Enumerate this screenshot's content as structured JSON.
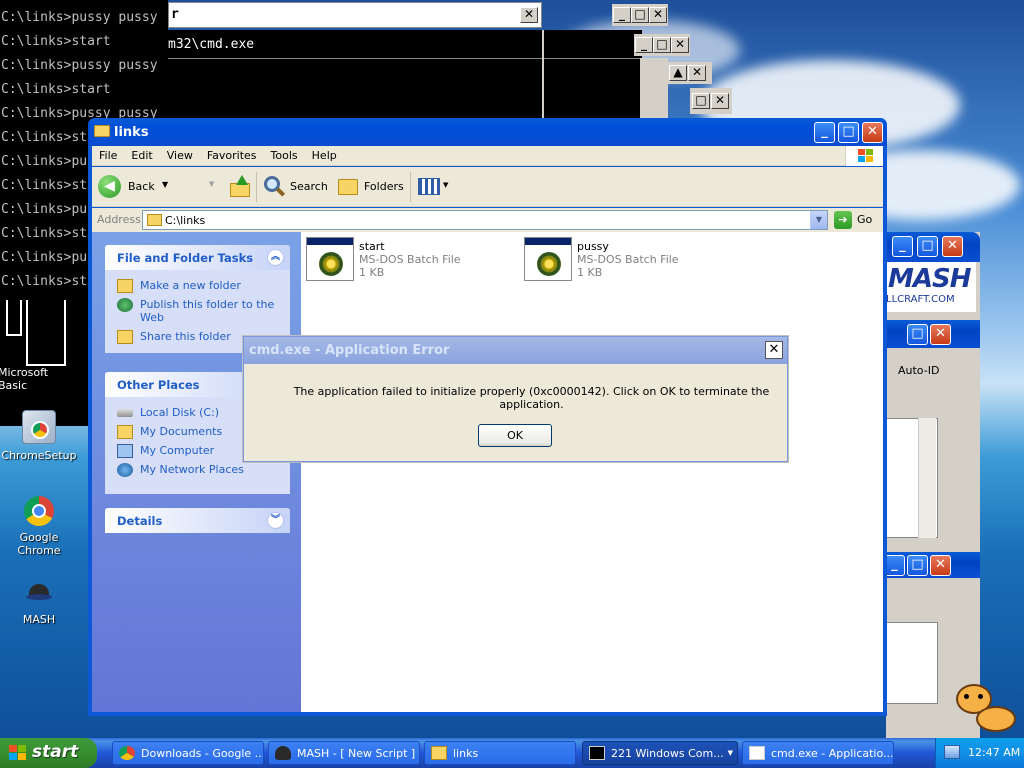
{
  "desktop": {
    "icons": [
      {
        "label": "Microsoft Basic"
      },
      {
        "label": "ChromeSetup"
      },
      {
        "label": "Google Chrome"
      },
      {
        "label": "MASH"
      }
    ]
  },
  "console": {
    "lines": [
      "C:\\links>pussy pussy",
      "C:\\links>start",
      "C:\\links>pussy pussy",
      "C:\\links>start",
      "C:\\links>pussy pussy",
      "C:\\links>st",
      "C:\\links>pu",
      "C:\\links>st",
      "C:\\links>pu",
      "C:\\links>st",
      "C:\\links>pu",
      "C:\\links>st"
    ],
    "window2_title_fragment": "r",
    "window3_title_fragment": "m32\\cmd.exe"
  },
  "explorer": {
    "title": "links",
    "menu": [
      "File",
      "Edit",
      "View",
      "Favorites",
      "Tools",
      "Help"
    ],
    "toolbar": {
      "back": "Back",
      "search": "Search",
      "folders": "Folders"
    },
    "address_label": "Address",
    "address_value": "C:\\links",
    "go_label": "Go",
    "tasks": {
      "file_folder_title": "File and Folder Tasks",
      "file_folder_items": [
        "Make a new folder",
        "Publish this folder to the Web",
        "Share this folder"
      ],
      "other_places_title": "Other Places",
      "other_places_items": [
        "Local Disk (C:)",
        "My Documents",
        "My Computer",
        "My Network Places"
      ],
      "details_title": "Details"
    },
    "files": [
      {
        "name": "start",
        "type": "MS-DOS Batch File",
        "size": "1 KB"
      },
      {
        "name": "pussy",
        "type": "MS-DOS Batch File",
        "size": "1 KB"
      }
    ]
  },
  "mash_window": {
    "logo": "MASH",
    "url": "LLCRAFT.COM",
    "auto_id": "Auto-ID"
  },
  "dialog": {
    "title": "cmd.exe - Application Error",
    "message": "The application failed to initialize properly (0xc0000142). Click on OK to terminate the application.",
    "ok": "OK"
  },
  "taskbar": {
    "start": "start",
    "buttons": [
      {
        "label": "Downloads - Google ..."
      },
      {
        "label": "MASH - [ New Script ] *"
      },
      {
        "label": "links"
      },
      {
        "label": "221 Windows Com..."
      },
      {
        "label": "cmd.exe - Applicatio..."
      }
    ],
    "clock": "12:47 AM"
  }
}
